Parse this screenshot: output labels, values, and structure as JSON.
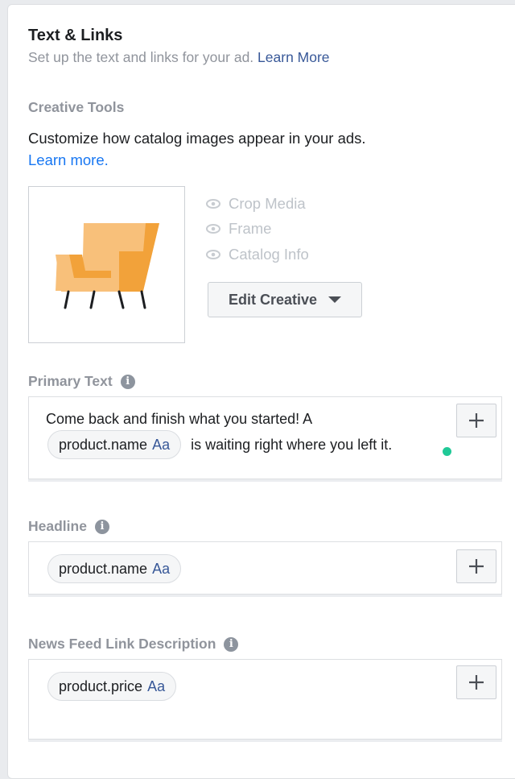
{
  "header": {
    "title": "Text & Links",
    "subtitle": "Set up the text and links for your ad.",
    "learn_more": "Learn More"
  },
  "creative_tools": {
    "label": "Creative Tools",
    "description": "Customize how catalog images appear in your ads.",
    "learn_more": "Learn more.",
    "thumbnail_icon": "armchair-icon",
    "options": [
      {
        "label": "Crop Media",
        "icon": "eye-icon"
      },
      {
        "label": "Frame",
        "icon": "eye-icon"
      },
      {
        "label": "Catalog Info",
        "icon": "eye-icon"
      }
    ],
    "edit_button": "Edit Creative"
  },
  "primary_text": {
    "label": "Primary Text",
    "line1": "Come back and finish what you started! A",
    "chip": {
      "name": "product.name",
      "case": "Aa"
    },
    "line2_rest": "is waiting right where you left it.",
    "status_color": "#20c997"
  },
  "headline": {
    "label": "Headline",
    "chip": {
      "name": "product.name",
      "case": "Aa"
    }
  },
  "link_description": {
    "label": "News Feed Link Description",
    "chip": {
      "name": "product.price",
      "case": "Aa"
    }
  },
  "colors": {
    "link": "#385898",
    "accent_link": "#1877f2",
    "muted": "#90949c"
  }
}
